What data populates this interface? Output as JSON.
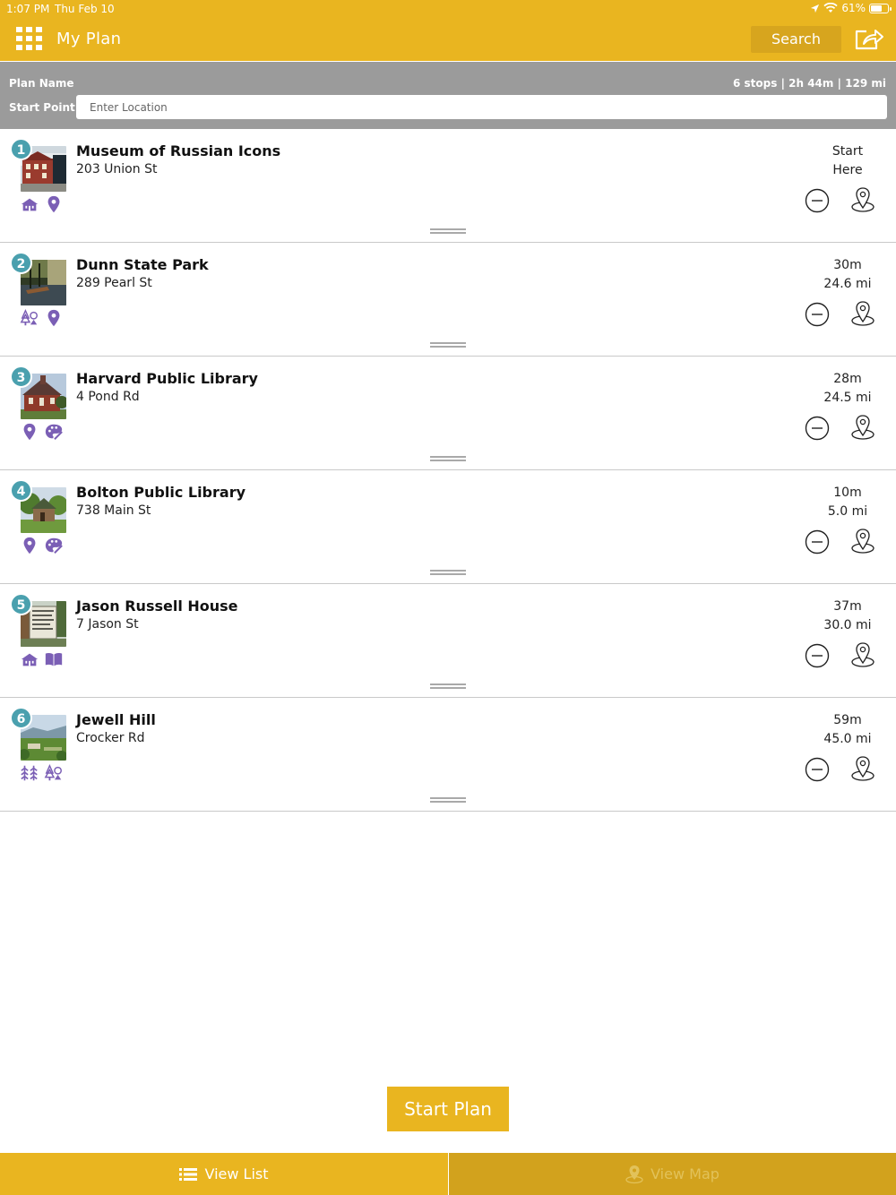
{
  "status": {
    "time": "1:07 PM",
    "date": "Thu Feb 10",
    "battery": "61%"
  },
  "header": {
    "title": "My Plan",
    "search_label": "Search"
  },
  "plan": {
    "name_label": "Plan Name",
    "stats": "6 stops | 2h 44m | 129 mi",
    "start_label": "Start Point",
    "start_placeholder": "Enter Location"
  },
  "stops": [
    {
      "number": "1",
      "name": "Museum of Russian Icons",
      "address": "203 Union St",
      "line1": "Start",
      "line2": "Here"
    },
    {
      "number": "2",
      "name": "Dunn State Park",
      "address": "289 Pearl St",
      "line1": "30m",
      "line2": "24.6 mi"
    },
    {
      "number": "3",
      "name": "Harvard Public Library",
      "address": "4 Pond Rd",
      "line1": "28m",
      "line2": "24.5 mi"
    },
    {
      "number": "4",
      "name": "Bolton Public Library",
      "address": "738 Main St",
      "line1": "10m",
      "line2": "5.0 mi"
    },
    {
      "number": "5",
      "name": "Jason Russell House",
      "address": "7 Jason St",
      "line1": "37m",
      "line2": "30.0 mi"
    },
    {
      "number": "6",
      "name": "Jewell Hill",
      "address": "Crocker Rd",
      "line1": "59m",
      "line2": "45.0 mi"
    }
  ],
  "start_button": "Start Plan",
  "tabs": {
    "list": "View List",
    "map": "View Map"
  },
  "colors": {
    "accent": "#e9b520",
    "plan_bar": "#9b9b9b",
    "badge": "#4aa0ae",
    "category_icon": "#7b5fb5"
  }
}
